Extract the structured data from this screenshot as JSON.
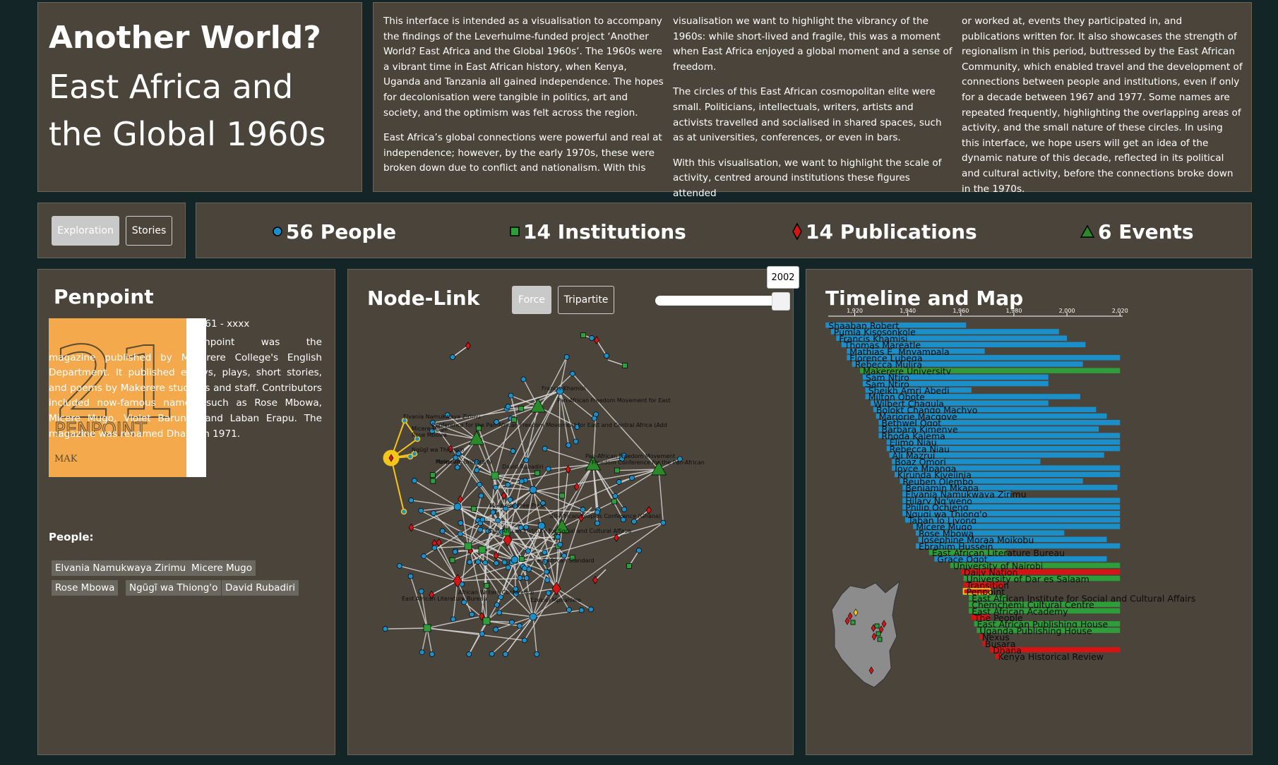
{
  "header": {
    "title": "Another World?",
    "subtitle": "East Africa and the Global 1960s"
  },
  "intro": {
    "col1": [
      "This interface is intended as a visualisation to accompany the findings of the Leverhulme-funded project ‘Another World? East Africa and the Global 1960s’. The 1960s were a vibrant time in East African history, when Kenya, Uganda and Tanzania all gained independence. The hopes for decolonisation were tangible in politics, art and society, and the optimism was felt across the region.",
      "East Africa’s global connections were powerful and real at independence; however, by the early 1970s, these were broken down due to conflict and nationalism. With this"
    ],
    "col2": [
      "visualisation we want to highlight the vibrancy of the 1960s: while short-lived and fragile, this was a moment when East Africa enjoyed a global moment and a sense of freedom.",
      "The circles of this East African cosmopolitan elite were small. Politicians, intellectuals, writers, artists and activists travelled and socialised in shared spaces, such as at universities, conferences, or even in bars.",
      "With this visualisation, we want to highlight the scale of activity, centred around institutions these figures attended"
    ],
    "col3": [
      "or worked at, events they participated in, and publications written for. It also showcases the strength of regionalism in this period, buttressed by the East African Community, which enabled travel and the development of connections between people and institutions, even if only for a decade between 1967 and 1977. Some names are repeated frequently, highlighting the overlapping areas of activity, and the small nature of these circles. In using this interface, we hope users will get an idea of the dynamic nature of this decade, reflected in its political and cultural activity, before the connections broke down in the 1970s."
    ]
  },
  "modes": {
    "exploration": "Exploration",
    "stories": "Stories"
  },
  "counts": {
    "people": "56 People",
    "institutions": "14 Institutions",
    "publications": "14 Publications",
    "events": "6 Events"
  },
  "colors": {
    "person": "#1a8fc9",
    "institution": "#2e9e3b",
    "publication": "#d51414",
    "event": "#2a8a2a",
    "highlight": "#f5c518"
  },
  "detail": {
    "title": "Penpoint",
    "dates": "1961 - xxxx",
    "description": "Penpoint was the magazine published by Makerere College's English Department. It published essays, plays, short stories, and poems by Makerere students and staff. Contributors included now-famous names, such as Rose Mbowa, Micere Mugo, Violet Barungi, and Laban Erapu. The magazine was renamed Dhana in 1971.",
    "cover_text": "PENPOINT",
    "cover_number": "21",
    "cover_initials": "MAK",
    "people_label": "People:",
    "people": [
      "Elvania Namukwaya Zirimu",
      "Micere Mugo",
      "Rose Mbowa",
      "Ngũgĩ wa Thiong'o",
      "David Rubadiri"
    ]
  },
  "network": {
    "title": "Node-Link",
    "force_label": "Force",
    "tripartite_label": "Tripartite",
    "slider_value": "2002",
    "labels": [
      "Elvania Namukwaya Zirimu",
      "Francis Khamisi",
      "Pan-African Freedom Movement for East",
      "Conference for the Pan-African Freedom Movement for East and Central Africa (Add",
      "Makerere University",
      "David Rubadiri",
      "Micere Mugo",
      "Rose Mbowa",
      "Ngũgĩ wa Thiong'o",
      "East African Institute for Social and Cultural Affairs",
      "All-African Peoples Conference (Ghana)",
      "East African Standard",
      "East African Literature Bureau",
      "Ezekiel Mphahlele",
      "Makerere Free Press",
      "African Writers Conference",
      "Penpoint",
      "Pan-African Freedom Movement",
      "Freedom Conference for the Pan-African"
    ]
  },
  "timeline": {
    "title": "Timeline and Map",
    "axis_ticks": [
      "1,920",
      "1,940",
      "1,960",
      "1,980",
      "2,000",
      "2,020"
    ],
    "rows": [
      {
        "name": "Shaaban Robert",
        "type": "person",
        "start": 1909,
        "end": 1962
      },
      {
        "name": "Pumla Kisosonkole",
        "type": "person",
        "start": 1911,
        "end": 1997
      },
      {
        "name": "Francis Khamisi",
        "type": "person",
        "start": 1913,
        "end": 2000
      },
      {
        "name": "Thomas Mareatle",
        "type": "person",
        "start": 1915,
        "end": 2007
      },
      {
        "name": "Mathias E. Mnyampala",
        "type": "person",
        "start": 1917,
        "end": 1969
      },
      {
        "name": "Florence Lubega",
        "type": "person",
        "start": 1917,
        "end": 2020
      },
      {
        "name": "Rebecca Mulira",
        "type": "person",
        "start": 1919,
        "end": 2006
      },
      {
        "name": "Makerere University",
        "type": "institution",
        "start": 1922,
        "end": 2020
      },
      {
        "name": "Sam Ntiro",
        "type": "person",
        "start": 1923,
        "end": 1993
      },
      {
        "name": "Sam Ntiro",
        "type": "person",
        "start": 1923,
        "end": 1993
      },
      {
        "name": "Sheikh Amri Abedi",
        "type": "person",
        "start": 1924,
        "end": 1964
      },
      {
        "name": "Milton Obote",
        "type": "person",
        "start": 1924,
        "end": 2005
      },
      {
        "name": "Wilbert Chagula",
        "type": "person",
        "start": 1926,
        "end": 1993
      },
      {
        "name": "Bolokt Chango Machyo",
        "type": "person",
        "start": 1927,
        "end": 2011
      },
      {
        "name": "Marjorie Macgoye",
        "type": "person",
        "start": 1928,
        "end": 2015
      },
      {
        "name": "Bethwel Ogot",
        "type": "person",
        "start": 1929,
        "end": 2020
      },
      {
        "name": "Barbara Kimenye",
        "type": "person",
        "start": 1929,
        "end": 2012
      },
      {
        "name": "Rhoda Kalema",
        "type": "person",
        "start": 1929,
        "end": 2020
      },
      {
        "name": "Elimo Njau",
        "type": "person",
        "start": 1932,
        "end": 2020
      },
      {
        "name": "Rebecca Njau",
        "type": "person",
        "start": 1932,
        "end": 2020
      },
      {
        "name": "Ali Mazrui",
        "type": "person",
        "start": 1933,
        "end": 2014
      },
      {
        "name": "Boaz Omori",
        "type": "person",
        "start": 1934,
        "end": 1990
      },
      {
        "name": "Joyce Mpanga",
        "type": "person",
        "start": 1934,
        "end": 2020
      },
      {
        "name": "Kirunda Kivejinja",
        "type": "person",
        "start": 1935,
        "end": 2020
      },
      {
        "name": "Reuben Olembo",
        "type": "person",
        "start": 1937,
        "end": 2006
      },
      {
        "name": "Benjamin Mkapa",
        "type": "person",
        "start": 1938,
        "end": 2019
      },
      {
        "name": "Elvania Namukwaya Zirimu",
        "type": "person",
        "start": 1938,
        "end": 1979
      },
      {
        "name": "Hilary Ng'weno",
        "type": "person",
        "start": 1938,
        "end": 2020
      },
      {
        "name": "Philip Ochieng",
        "type": "person",
        "start": 1938,
        "end": 2020
      },
      {
        "name": "Ngugi wa Thiong'o",
        "type": "person",
        "start": 1938,
        "end": 2020
      },
      {
        "name": "Taban lo Liyong",
        "type": "person",
        "start": 1939,
        "end": 2020
      },
      {
        "name": "Micere Mugo",
        "type": "person",
        "start": 1942,
        "end": 2020
      },
      {
        "name": "Rose Mbowa",
        "type": "person",
        "start": 1943,
        "end": 1999
      },
      {
        "name": "Josephine Moraa Moikobu",
        "type": "person",
        "start": 1944,
        "end": 2015
      },
      {
        "name": "Ebrahim Hussein",
        "type": "person",
        "start": 1943,
        "end": 2020
      },
      {
        "name": "East African Literature Bureau",
        "type": "institution",
        "start": 1948,
        "end": 1977
      },
      {
        "name": "Grace Ogot",
        "type": "person",
        "start": 1950,
        "end": 2015
      },
      {
        "name": "University of Nairobi",
        "type": "institution",
        "start": 1956,
        "end": 2020
      },
      {
        "name": "Daily Nation",
        "type": "publication",
        "start": 1960,
        "end": 2020
      },
      {
        "name": "University of Dar es Salaam",
        "type": "institution",
        "start": 1961,
        "end": 2020
      },
      {
        "name": "Transition",
        "type": "publication",
        "start": 1961,
        "end": 1976
      },
      {
        "name": "Penpoint",
        "type": "publication",
        "start": 1961,
        "end": 1971,
        "highlight": true
      },
      {
        "name": "East African Institute for Social and Cultural Affairs",
        "type": "institution",
        "start": 1963,
        "end": 1977
      },
      {
        "name": "Chemchemi Cultural Centre",
        "type": "institution",
        "start": 1963,
        "end": 2020
      },
      {
        "name": "East African Academy",
        "type": "institution",
        "start": 1963,
        "end": 2020
      },
      {
        "name": "The People",
        "type": "publication",
        "start": 1964,
        "end": 1971
      },
      {
        "name": "East African Publishing House",
        "type": "institution",
        "start": 1965,
        "end": 2020
      },
      {
        "name": "Uganda Publishing House",
        "type": "institution",
        "start": 1966,
        "end": 2020
      },
      {
        "name": "Nexus",
        "type": "publication",
        "start": 1967,
        "end": 1968
      },
      {
        "name": "Busara",
        "type": "publication",
        "start": 1968,
        "end": 1970
      },
      {
        "name": "Dhana",
        "type": "publication",
        "start": 1971,
        "end": 2020
      },
      {
        "name": "Kenya Historical Review",
        "type": "publication",
        "start": 1973,
        "end": 1975
      }
    ]
  }
}
